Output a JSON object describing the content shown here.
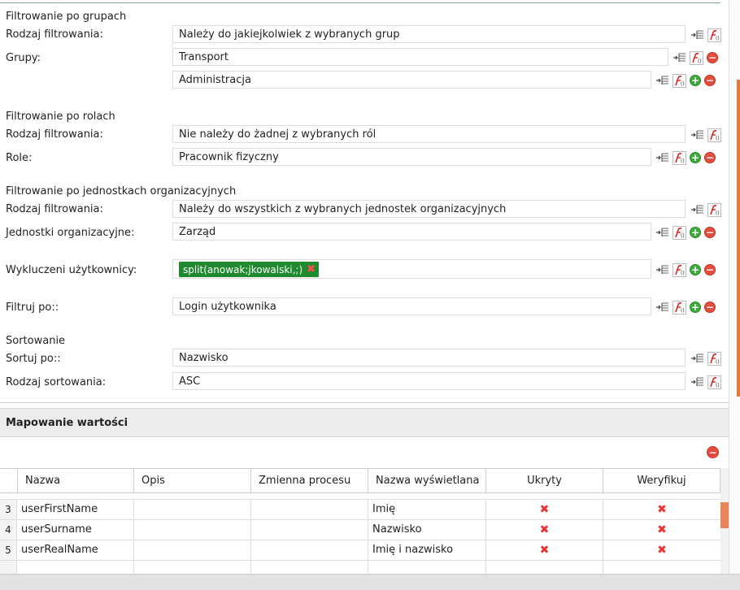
{
  "groups_filter": {
    "section_title": "Filtrowanie po grupach",
    "filter_type_label": "Rodzaj filtrowania:",
    "filter_type_value": "Należy do jakiejkolwiek z wybranych grup",
    "groups_label": "Grupy:",
    "groups": [
      "Transport",
      "Administracja"
    ]
  },
  "roles_filter": {
    "section_title": "Filtrowanie po rolach",
    "filter_type_label": "Rodzaj filtrowania:",
    "filter_type_value": "Nie należy do żadnej z wybranych ról",
    "roles_label": "Role:",
    "roles": [
      "Pracownik fizyczny"
    ]
  },
  "units_filter": {
    "section_title": "Filtrowanie po jednostkach organizacyjnych",
    "filter_type_label": "Rodzaj filtrowania:",
    "filter_type_value": "Należy do wszystkich z wybranych jednostek organizacyjnych",
    "units_label": "Jednostki organizacyjne:",
    "units": [
      "Zarząd"
    ]
  },
  "excluded_users": {
    "label": "Wykluczeni użytkownicy:",
    "chip": "split(anowak;jkowalski,;)"
  },
  "filter_by": {
    "label": "Filtruj po::",
    "value": "Login użytkownika"
  },
  "sorting": {
    "section_title": "Sortowanie",
    "sort_by_label": "Sortuj po::",
    "sort_by_value": "Nazwisko",
    "sort_type_label": "Rodzaj sortowania:",
    "sort_type_value": "ASC"
  },
  "value_mapping": {
    "title": "Mapowanie wartości",
    "columns": [
      "Nazwa",
      "Opis",
      "Zmienna procesu",
      "Nazwa wyświetlana",
      "Ukryty",
      "Weryfikuj"
    ],
    "rows": [
      {
        "num": "3",
        "name": "userFirstName",
        "desc": "",
        "var": "",
        "display": "Imię",
        "hidden": "✖",
        "verify": "✖"
      },
      {
        "num": "4",
        "name": "userSurname",
        "desc": "",
        "var": "",
        "display": "Nazwisko",
        "hidden": "✖",
        "verify": "✖"
      },
      {
        "num": "5",
        "name": "userRealName",
        "desc": "",
        "var": "",
        "display": "Imię i nazwisko",
        "hidden": "✖",
        "verify": "✖"
      }
    ]
  },
  "icons": {
    "arrow_list": "arrow-list-icon",
    "fx": "function-editor-icon",
    "add": "add-icon",
    "remove": "remove-icon"
  },
  "colors": {
    "add": "#3fa93f",
    "remove": "#e44c3c",
    "chip_bg": "#1f8a2e",
    "scroll_accent": "#e07b3c"
  }
}
